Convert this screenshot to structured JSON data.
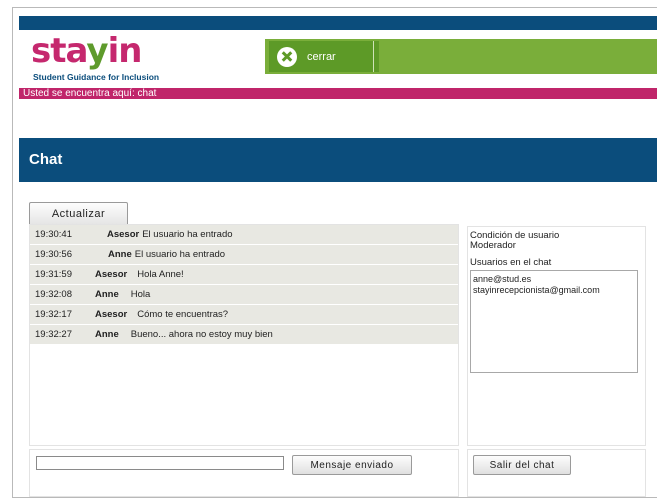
{
  "header": {
    "logo_part1": "sta",
    "logo_part2": "y",
    "logo_part3": "in",
    "logo_tagline": "Student Guidance for Inclusion",
    "close_label": "cerrar",
    "breadcrumb": "Usted se encuentra aquí: chat"
  },
  "page": {
    "title": "Chat"
  },
  "toolbar": {
    "refresh_label": "Actualizar"
  },
  "messages": [
    {
      "time": "19:30:41",
      "user": "Asesor",
      "text": "El usuario ha entrado"
    },
    {
      "time": "19:30:56",
      "user": "Anne",
      "text": "El usuario ha entrado"
    },
    {
      "time": "19:31:59",
      "user": "Asesor",
      "text": "Hola Anne!"
    },
    {
      "time": "19:32:08",
      "user": "Anne",
      "text": "Hola"
    },
    {
      "time": "19:32:17",
      "user": "Asesor",
      "text": "Cómo te encuentras?"
    },
    {
      "time": "19:32:27",
      "user": "Anne",
      "text": "Bueno... ahora no estoy muy bien"
    }
  ],
  "sidebar": {
    "condition_label": "Condición de usuario",
    "condition_value": "Moderador",
    "users_label": "Usuarios en el chat",
    "users": [
      "anne@stud.es",
      "stayinrecepcionista@gmail.com"
    ]
  },
  "composer": {
    "input_value": "",
    "send_label": "Mensaje enviado",
    "leave_label": "Salir del chat"
  },
  "colors": {
    "navy": "#0b4d7c",
    "magenta": "#c0256a",
    "green": "#7aae3a",
    "dark_green": "#5d9a27"
  }
}
